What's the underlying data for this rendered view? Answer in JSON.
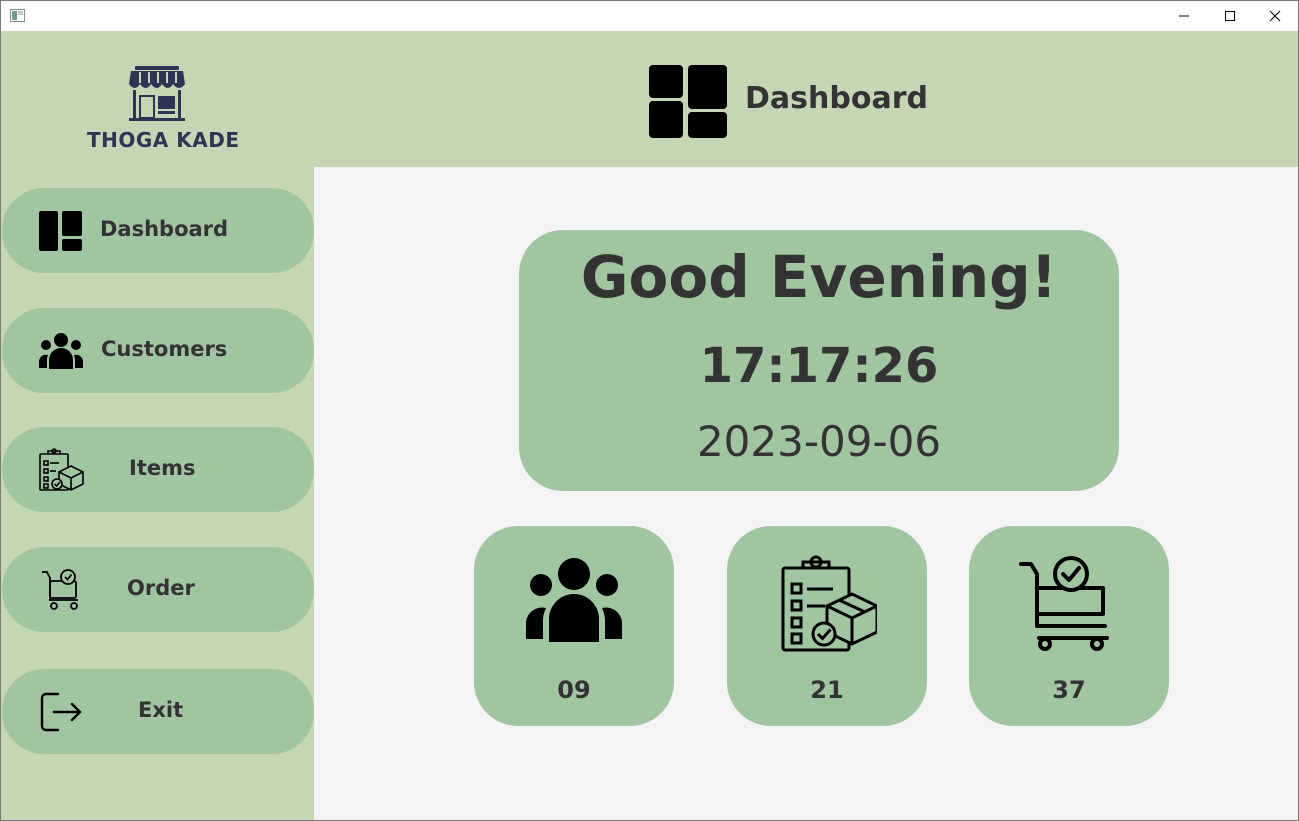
{
  "window": {
    "title": "",
    "controls": [
      "minimize-icon",
      "maximize-icon",
      "close-icon"
    ]
  },
  "brand": {
    "name": "THOGA KADE",
    "icon": "shop-icon",
    "color": "#2c3654"
  },
  "header": {
    "title": "Dashboard",
    "icon": "dashboard-icon"
  },
  "sidebar": {
    "items": [
      {
        "label": "Dashboard",
        "icon": "dashboard-icon"
      },
      {
        "label": "Customers",
        "icon": "users-icon"
      },
      {
        "label": "Items",
        "icon": "clipboard-box-icon"
      },
      {
        "label": "Order",
        "icon": "cart-check-icon"
      },
      {
        "label": "Exit",
        "icon": "logout-icon"
      }
    ]
  },
  "greeting": {
    "title": "Good Evening!",
    "time": "17:17:26",
    "date": "2023-09-06"
  },
  "stats": [
    {
      "icon": "users-icon",
      "value": "09"
    },
    {
      "icon": "clipboard-box-icon",
      "value": "21"
    },
    {
      "icon": "cart-check-icon",
      "value": "37"
    }
  ],
  "colors": {
    "panel": "#c5d6b5",
    "card": "#a1c5a0",
    "content": "#f4f4f4",
    "text": "#333333"
  }
}
